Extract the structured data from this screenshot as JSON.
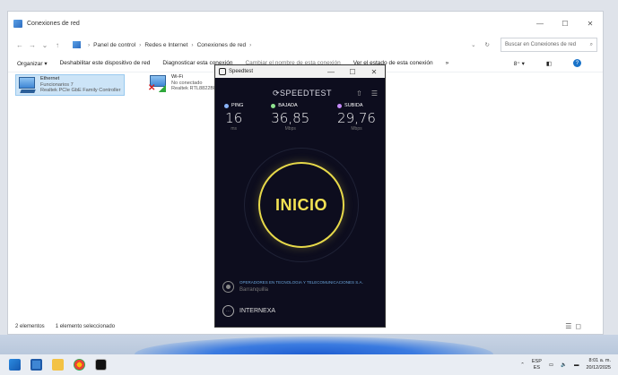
{
  "explorer": {
    "title": "Conexiones de red",
    "breadcrumb": [
      "Panel de control",
      "Redes e Internet",
      "Conexiones de red"
    ],
    "search_placeholder": "Buscar en Conexiones de red",
    "toolbar": [
      "Organizar ▾",
      "Deshabilitar este dispositivo de red",
      "Diagnosticar esta conexión",
      "Cambiar el nombre de esta conexión",
      "Ver el estado de esta conexión",
      "»"
    ],
    "adapters": [
      {
        "name": "Ethernet",
        "status": "Funcionarios 7",
        "device": "Realtek PCIe GbE Family Controller",
        "selected": true
      },
      {
        "name": "Wi-Fi",
        "status": "No conectado",
        "device": "Realtek RTL8822BE",
        "selected": false
      }
    ],
    "status": {
      "items": "2 elementos",
      "selected": "1 elemento seleccionado"
    }
  },
  "speedtest": {
    "title": "Speedtest",
    "logo": "SPEEDTEST",
    "metrics": [
      {
        "label": "PING",
        "value": "16",
        "unit": "ms",
        "color": "#8ab4f8"
      },
      {
        "label": "BAJADA",
        "value": "36,85",
        "unit": "Mbps",
        "color": "#8fe38f"
      },
      {
        "label": "SUBIDA",
        "value": "29,76",
        "unit": "Mbps",
        "color": "#c58af9"
      }
    ],
    "go_label": "INICIO",
    "provider": "OPERADORES EN TECNOLOGIA Y TELECOMUNICACIONES S.A.",
    "city": "Barranquilla",
    "server": "INTERNEXA"
  },
  "taskbar": {
    "lang_top": "ESP",
    "lang_bottom": "ES",
    "time": "8:01 a. m.",
    "date": "20/12/2025"
  }
}
